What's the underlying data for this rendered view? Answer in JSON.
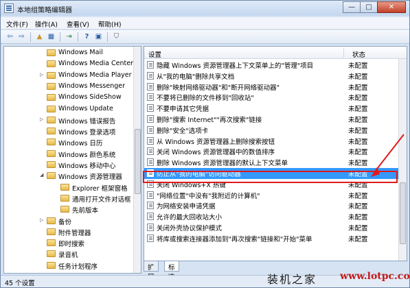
{
  "window": {
    "title": "本地组策略编辑器",
    "controls": [
      "—",
      "□",
      "✕"
    ]
  },
  "menu": [
    "文件(F)",
    "操作(A)",
    "查看(V)",
    "帮助(H)"
  ],
  "toolbar": {
    "icons": [
      "back-arrow-icon",
      "forward-arrow-icon",
      "folder-up-icon",
      "console-tree-icon",
      "export-icon",
      "help-icon",
      "properties-icon",
      "filter-icon"
    ],
    "glyphs": [
      "⇦",
      "⇨",
      "▲",
      "▦",
      "⇥",
      "?",
      "▣",
      "⛉"
    ]
  },
  "tree": [
    {
      "label": "Windows Mail",
      "arrow": ""
    },
    {
      "label": "Windows Media Center",
      "arrow": ""
    },
    {
      "label": "Windows Media Player",
      "arrow": "▷"
    },
    {
      "label": "Windows Messenger",
      "arrow": ""
    },
    {
      "label": "Windows SideShow",
      "arrow": ""
    },
    {
      "label": "Windows Update",
      "arrow": ""
    },
    {
      "label": "Windows 错误报告",
      "arrow": "▷"
    },
    {
      "label": "Windows 登录选项",
      "arrow": ""
    },
    {
      "label": "Windows 日历",
      "arrow": ""
    },
    {
      "label": "Windows 颜色系统",
      "arrow": ""
    },
    {
      "label": "Windows 移动中心",
      "arrow": ""
    },
    {
      "label": "Windows 资源管理器",
      "arrow": "◢"
    },
    {
      "label": "Explorer 框架窗格",
      "arrow": ""
    },
    {
      "label": "通用打开文件对话框",
      "arrow": ""
    },
    {
      "label": "先前版本",
      "arrow": ""
    },
    {
      "label": "备份",
      "arrow": "▷"
    },
    {
      "label": "附件管理器",
      "arrow": ""
    },
    {
      "label": "即时搜索",
      "arrow": ""
    },
    {
      "label": "录音机",
      "arrow": ""
    },
    {
      "label": "任务计划程序",
      "arrow": ""
    }
  ],
  "list": {
    "header_setting": "设置",
    "header_state": "状态",
    "rows": [
      {
        "name": "隐藏 Windows 资源管理器上下文菜单上的\"管理\"项目",
        "state": "未配置"
      },
      {
        "name": "从\"我的电脑\"删除共享文档",
        "state": "未配置"
      },
      {
        "name": "删除\"映射网络驱动器\"和\"断开网络驱动器\"",
        "state": "未配置"
      },
      {
        "name": "不要将已删除的文件移到\"回收站\"",
        "state": "未配置"
      },
      {
        "name": "不要申请其它凭据",
        "state": "未配置"
      },
      {
        "name": "删除\"搜索 Internet\"\"再次搜索\"链接",
        "state": "未配置"
      },
      {
        "name": "删除\"安全\"选项卡",
        "state": "未配置"
      },
      {
        "name": "从 Windows 资源管理器上删除搜索按钮",
        "state": "未配置"
      },
      {
        "name": "关闭 Windows 资源管理器中的数值排序",
        "state": "未配置"
      },
      {
        "name": "删除 Windows 资源管理器的默认上下文菜单",
        "state": "未配置"
      },
      {
        "name": "防止从\"我的电脑\"访问驱动器",
        "state": "未配置",
        "selected": true
      },
      {
        "name": "关闭 Windows+X 热键",
        "state": "未配置"
      },
      {
        "name": "\"网络位置\"中没有\"我附近的计算机\"",
        "state": "未配置"
      },
      {
        "name": "为网络安装申请凭据",
        "state": "未配置"
      },
      {
        "name": "允许的最大回收站大小",
        "state": "未配置"
      },
      {
        "name": "关闭外壳协议保护模式",
        "state": "未配置"
      },
      {
        "name": "将库或搜索连接器添加到\"再次搜索\"链接和\"开始\"菜单",
        "state": "未配置"
      }
    ]
  },
  "tabs": [
    "扩展",
    "标准"
  ],
  "status": "45 个设置",
  "watermark": {
    "chinese": "装机之家",
    "url": "www.lotpc.com"
  },
  "colors": {
    "selection": "#3399ff",
    "annotation": "#e01a1a",
    "watermark_url": "#c41b1b"
  }
}
